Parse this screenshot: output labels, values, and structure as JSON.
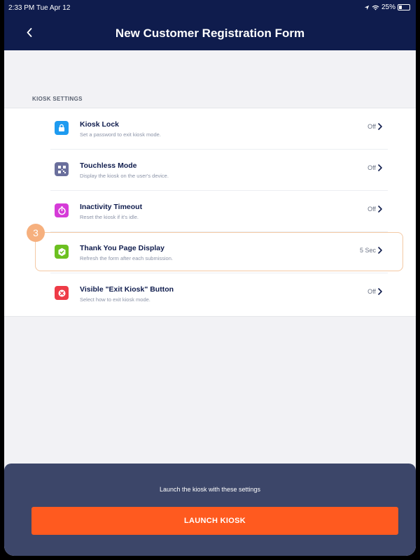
{
  "status_bar": {
    "time": "2:33 PM  Tue Apr 12",
    "battery": "25%"
  },
  "header": {
    "title": "New Customer Registration Form",
    "back_icon": "chevron-left-icon"
  },
  "section": {
    "title": "KIOSK SETTINGS"
  },
  "settings": [
    {
      "title": "Kiosk Lock",
      "subtitle": "Set a password to exit kiosk mode.",
      "value": "Off",
      "icon": "lock-icon",
      "color": "#1e9bf0"
    },
    {
      "title": "Touchless Mode",
      "subtitle": "Display the kiosk on the user's device.",
      "value": "Off",
      "icon": "qr-code-icon",
      "color": "#6a6f9c"
    },
    {
      "title": "Inactivity Timeout",
      "subtitle": "Reset the kiosk if it's idle.",
      "value": "Off",
      "icon": "timer-icon",
      "color": "#d63bd8"
    },
    {
      "title": "Thank You Page Display",
      "subtitle": "Refresh the form after each submission.",
      "value": "5 Sec",
      "icon": "check-icon",
      "color": "#6cc020"
    },
    {
      "title": "Visible \"Exit Kiosk\" Button",
      "subtitle": "Select how to exit kiosk mode.",
      "value": "Off",
      "icon": "close-icon",
      "color": "#ee3b47"
    }
  ],
  "highlight": {
    "step_number": "3"
  },
  "footer": {
    "caption": "Launch the kiosk with these settings",
    "button_label": "LAUNCH KIOSK",
    "button_color": "#ff5a1f"
  }
}
